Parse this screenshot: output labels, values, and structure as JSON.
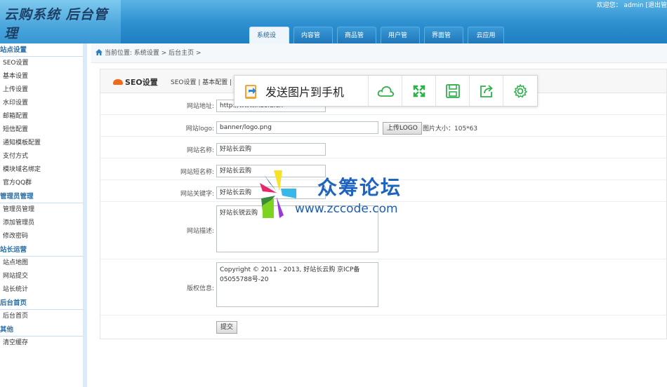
{
  "header": {
    "logo_text": "云购系统 后台管理",
    "welcome": "欢迎您： admin [退出管",
    "nav": [
      "系统设置",
      "内容管理",
      "商品管理",
      "用户管理",
      "界面管理",
      "云应用"
    ]
  },
  "sidebar": {
    "groups": [
      {
        "title": "站点设置",
        "items": [
          "SEO设置",
          "基本设置",
          "上传设置",
          "水印设置",
          "邮箱配置",
          "短信配置",
          "通知模板配置",
          "支付方式",
          "模块域名绑定",
          "官方QQ群"
        ]
      },
      {
        "title": "管理员管理",
        "items": [
          "管理员管理",
          "添加管理员",
          "修改密码"
        ]
      },
      {
        "title": "站长运营",
        "items": [
          "站点地图",
          "网站提交",
          "站长统计"
        ]
      },
      {
        "title": "后台首页",
        "items": [
          "后台首页"
        ]
      },
      {
        "title": "其他",
        "items": [
          "清空缓存"
        ]
      }
    ]
  },
  "breadcrumb": "当前位置: 系统设置 > 后台主页 >",
  "panel": {
    "title": "SEO设置",
    "links": "SEO设置 | 基本配置 |"
  },
  "form": {
    "site_url_label": "网站地址:",
    "site_url_value": "http://www.haoid.cn",
    "logo_label": "网站logo:",
    "logo_value": "banner/logo.png",
    "upload_button": "上传LOGO",
    "logo_size_hint": "图片大小：105*63",
    "site_name_label": "网站名称:",
    "site_name_value": "好站长云购",
    "short_name_label": "网站短名称:",
    "short_name_value": "好站长云购",
    "keywords_label": "网站关键字:",
    "keywords_value": "好站长云购",
    "description_label": "网站描述:",
    "description_value": "好站长锐云购",
    "copyright_label": "版权信息:",
    "copyright_value": "Copyright © 2011 - 2013, 好站长云购 京ICP备05055788号-20",
    "submit_button": "提交"
  },
  "float_toolbar": {
    "send_label": "发送图片到手机",
    "icons": [
      "send-to-phone-icon",
      "cloud-icon",
      "fullscreen-icon",
      "save-icon",
      "share-icon",
      "settings-icon"
    ],
    "accent_color": "#2fb14a"
  },
  "watermark": {
    "cn": "众筹论坛",
    "en": "www.zccode.com"
  }
}
